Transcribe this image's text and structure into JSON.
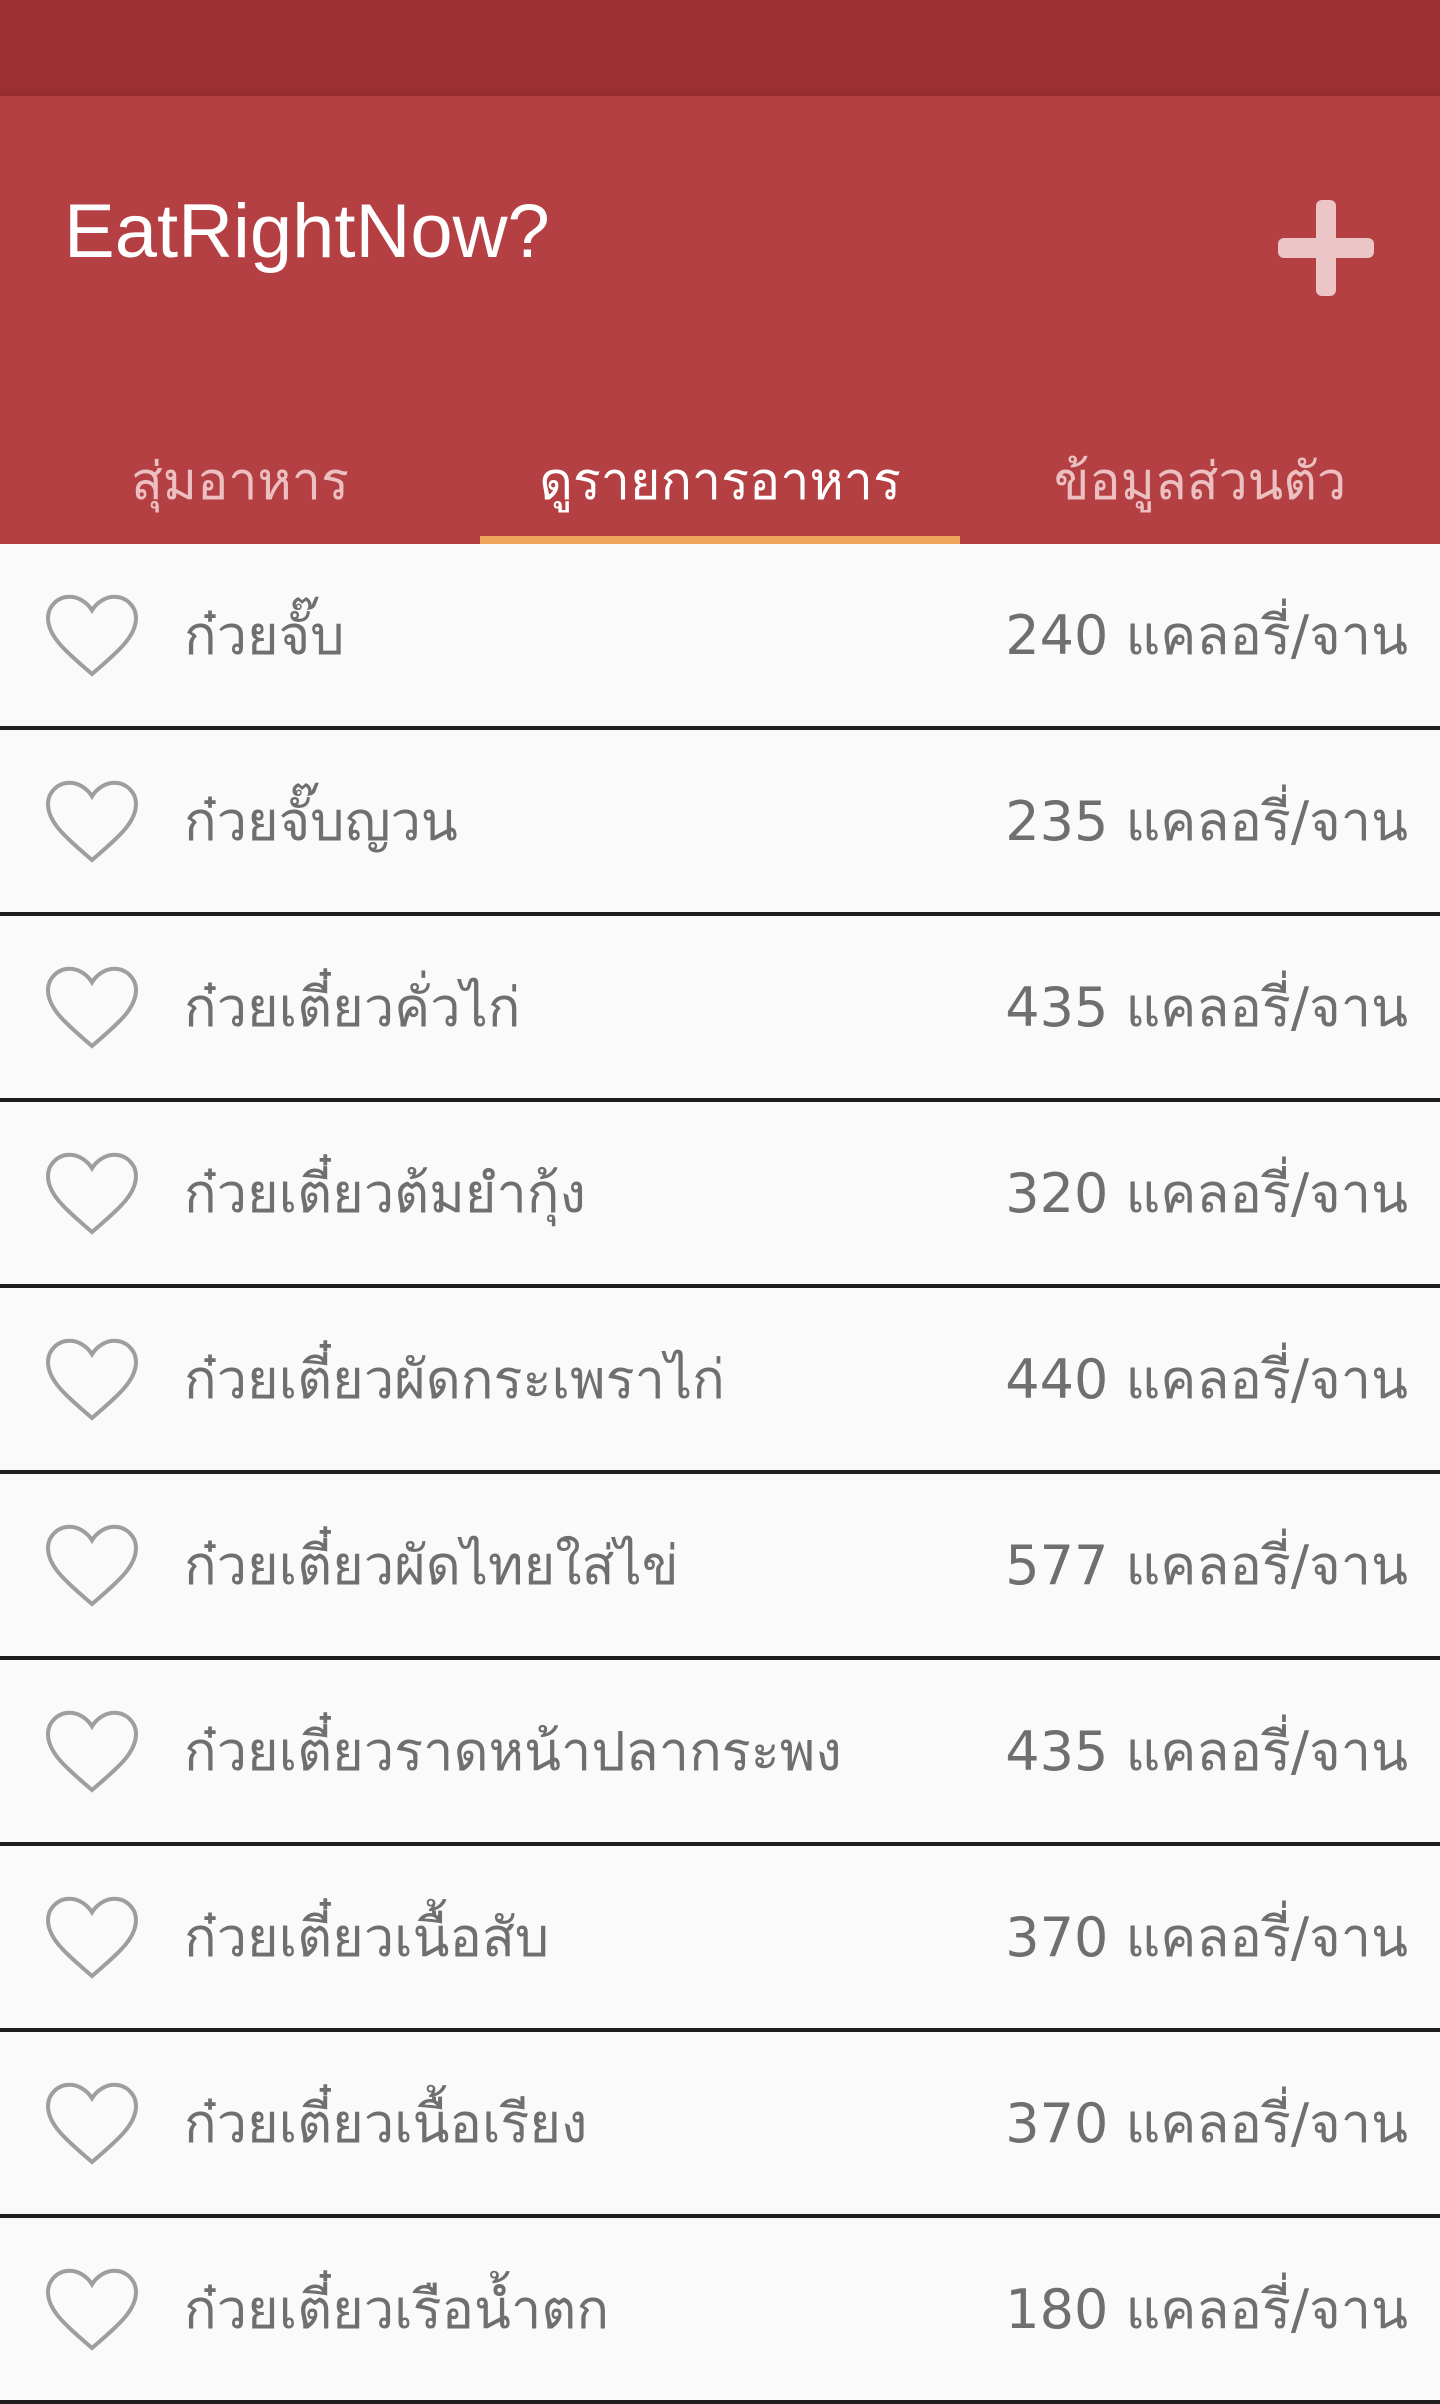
{
  "app": {
    "title": "EatRightNow?",
    "add_icon": "plus-icon",
    "colors": {
      "status_bar": "#9b2f33",
      "app_bar": "#b44043",
      "tab_indicator": "#f0a45c",
      "text_secondary": "#6f6f6f"
    }
  },
  "tabs": [
    {
      "label": "สุ่มอาหาร",
      "active": false
    },
    {
      "label": "ดูรายการอาหาร",
      "active": true
    },
    {
      "label": "ข้อมูลส่วนตัว",
      "active": false
    }
  ],
  "food_list": {
    "favorite_icon": "heart-outline-icon",
    "items": [
      {
        "name": "ก๋วยจั๊บ",
        "calories": "240 แคลอรี่/จาน"
      },
      {
        "name": "ก๋วยจั๊บญวน",
        "calories": "235 แคลอรี่/จาน"
      },
      {
        "name": "ก๋วยเตี๋ยวคั่วไก่",
        "calories": "435 แคลอรี่/จาน"
      },
      {
        "name": "ก๋วยเตี๋ยวต้มยำกุ้ง",
        "calories": "320 แคลอรี่/จาน"
      },
      {
        "name": "ก๋วยเตี๋ยวผัดกระเพราไก่",
        "calories": "440 แคลอรี่/จาน"
      },
      {
        "name": "ก๋วยเตี๋ยวผัดไทยใส่ไข่",
        "calories": "577 แคลอรี่/จาน"
      },
      {
        "name": "ก๋วยเตี๋ยวราดหน้าปลากระพง",
        "calories": "435 แคลอรี่/จาน"
      },
      {
        "name": "ก๋วยเตี๋ยวเนื้อสับ",
        "calories": "370 แคลอรี่/จาน"
      },
      {
        "name": "ก๋วยเตี๋ยวเนื้อเรียง",
        "calories": "370 แคลอรี่/จาน"
      },
      {
        "name": "ก๋วยเตี๋ยวเรือน้ำตก",
        "calories": "180 แคลอรี่/จาน"
      }
    ]
  }
}
